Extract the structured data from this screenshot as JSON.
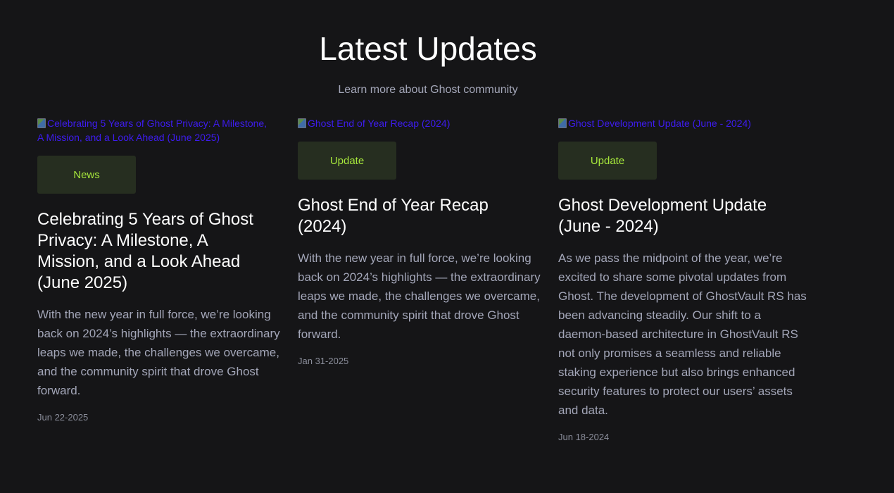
{
  "header": {
    "title": "Latest Updates",
    "subtitle": "Learn more about Ghost community"
  },
  "posts": [
    {
      "image_alt": "Celebrating 5 Years of Ghost Privacy: A Milestone, A Mission, and a Look Ahead (June 2025)",
      "tag": "News",
      "title": "Celebrating 5 Years of Ghost Privacy: A Milestone, A Mission, and a Look Ahead (June 2025)",
      "excerpt": "With the new year in full force, we’re looking back on 2024’s highlights — the extraordinary leaps we made, the challenges we overcame, and the community spirit that drove Ghost forward.",
      "date": "Jun 22-2025"
    },
    {
      "image_alt": "Ghost End of Year Recap (2024)",
      "tag": "Update",
      "title": "Ghost End of Year Recap (2024)",
      "excerpt": "With the new year in full force, we’re looking back on 2024’s highlights — the extraordinary leaps we made, the challenges we overcame, and the community spirit that drove Ghost forward.",
      "date": "Jan 31-2025"
    },
    {
      "image_alt": "Ghost Development Update (June - 2024)",
      "tag": "Update",
      "title": "Ghost Development Update (June - 2024)",
      "excerpt": "As we pass the midpoint of the year, we’re excited to share some pivotal updates from Ghost. The development of GhostVault RS has been advancing steadily. Our shift to a daemon-based architecture in GhostVault RS not only promises a seamless and reliable staking experience but also brings enhanced security features to protect our users’ assets and data.",
      "date": "Jun 18-2024"
    }
  ],
  "colors": {
    "background": "#151517",
    "tag_background": "#262e20",
    "tag_text": "#a7e83c",
    "link_alt_text": "#3e1cf0",
    "muted_text": "#a3a6b8"
  }
}
